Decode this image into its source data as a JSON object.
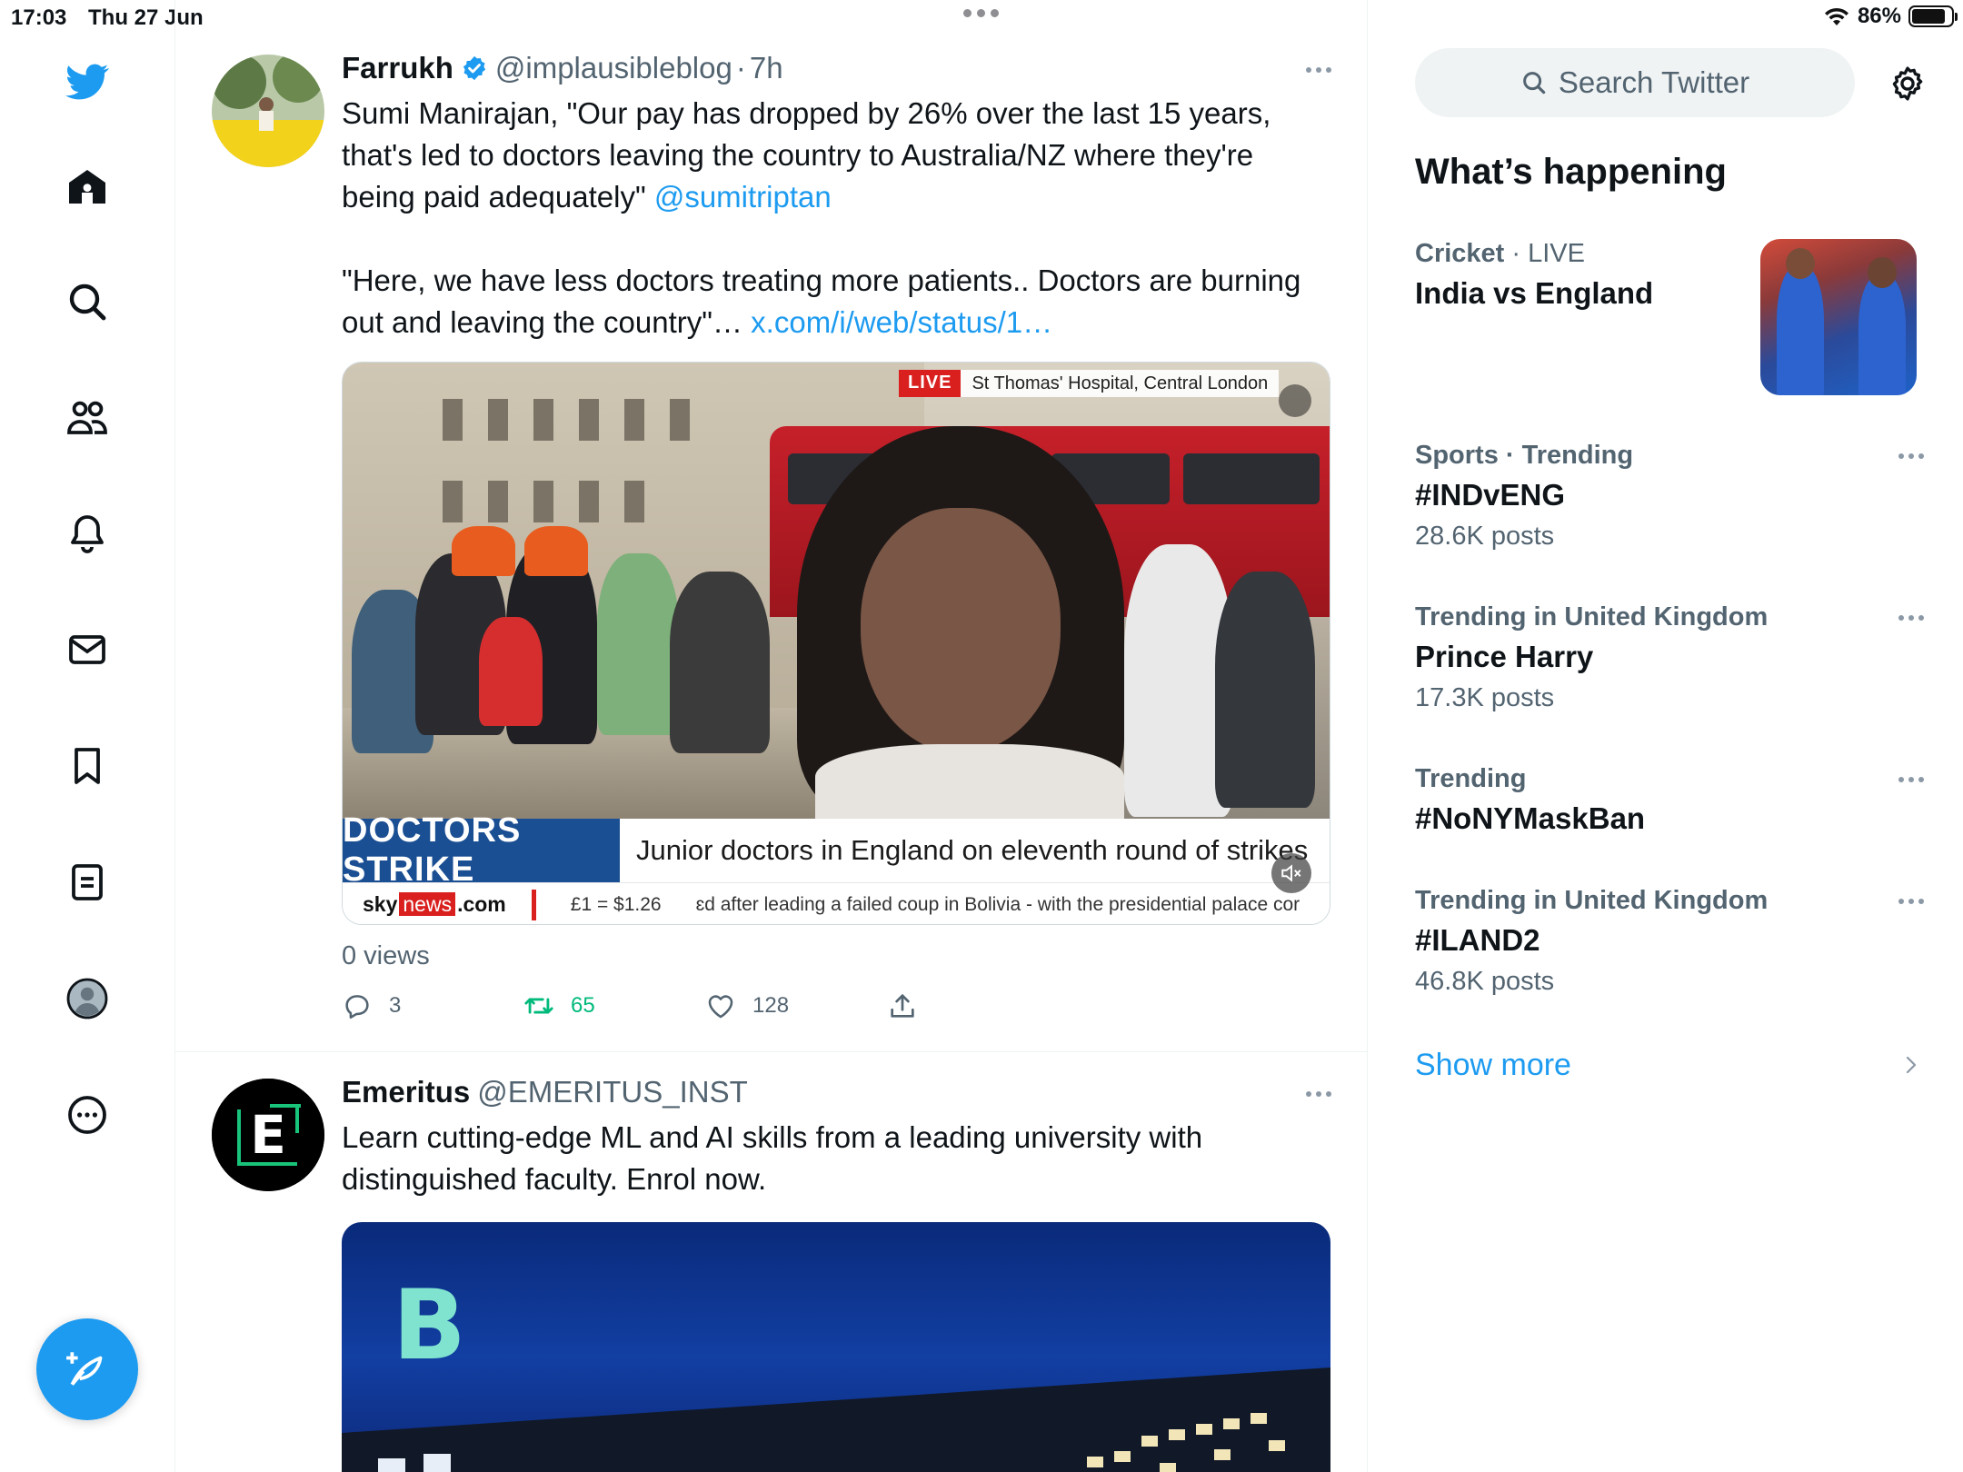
{
  "status_bar": {
    "time": "17:03",
    "date": "Thu 27 Jun",
    "battery_text": "86%",
    "battery_level": 0.86
  },
  "nav": {
    "items": [
      {
        "name": "twitter-logo",
        "icon": "bird-icon"
      },
      {
        "name": "home",
        "icon": "home-icon"
      },
      {
        "name": "explore",
        "icon": "search-icon"
      },
      {
        "name": "communities",
        "icon": "people-icon"
      },
      {
        "name": "notifications",
        "icon": "bell-icon"
      },
      {
        "name": "messages",
        "icon": "envelope-icon"
      },
      {
        "name": "bookmarks",
        "icon": "bookmark-icon"
      },
      {
        "name": "lists",
        "icon": "list-icon"
      },
      {
        "name": "profile",
        "icon": "avatar-icon"
      },
      {
        "name": "more",
        "icon": "more-circle-icon"
      }
    ],
    "compose_icon": "compose-feather-icon",
    "accent": "#1d9bf0"
  },
  "tweets": [
    {
      "author": "Farrukh",
      "verified": true,
      "handle": "@implausibleblog",
      "time": "7h",
      "text_1": "Sumi Manirajan, \"Our pay has dropped by 26% over the last 15 years, that's led to doctors leaving the country to Australia/NZ where they're being paid adequately\" ",
      "mention": "@sumitriptan",
      "text_2": "\"Here, we have less doctors treating more patients.. Doctors are burning out and leaving the country\"… ",
      "link": "x.com/i/web/status/1…",
      "media": {
        "live_label": "LIVE",
        "location": "St Thomas' Hospital, Central London",
        "headline": "DOCTORS STRIKE",
        "strap": "Junior doctors in England on eleventh round of strikes",
        "ticker_logo_sky": "sky",
        "ticker_logo_news": "news",
        "ticker_logo_com": ".com",
        "ticker_fx": "£1 = $1.26",
        "ticker_news": "ɛd after leading a failed coup in Bolivia - with the presidential palace cor"
      },
      "views": "0 views",
      "replies": "3",
      "retweets": "65",
      "likes": "128"
    },
    {
      "author": "Emeritus",
      "handle": "@EMERITUS_INST",
      "avatar_letter": "E",
      "text": "Learn cutting-edge ML and AI skills from a leading university with distinguished faculty. Enrol now.",
      "media_logo": "B"
    }
  ],
  "sidebar": {
    "search_placeholder": "Search Twitter",
    "section_title": "What’s happening",
    "trends": [
      {
        "category": "Cricket",
        "context": "LIVE",
        "name": "India vs England",
        "count": ""
      },
      {
        "category": "Sports · Trending",
        "context": "",
        "name": "#INDvENG",
        "count": "28.6K posts"
      },
      {
        "category": "Trending in United Kingdom",
        "context": "",
        "name": "Prince Harry",
        "count": "17.3K posts"
      },
      {
        "category": "Trending",
        "context": "",
        "name": "#NoNYMaskBan",
        "count": ""
      },
      {
        "category": "Trending in United Kingdom",
        "context": "",
        "name": "#ILAND2",
        "count": "46.8K posts"
      }
    ],
    "show_more": "Show more"
  }
}
